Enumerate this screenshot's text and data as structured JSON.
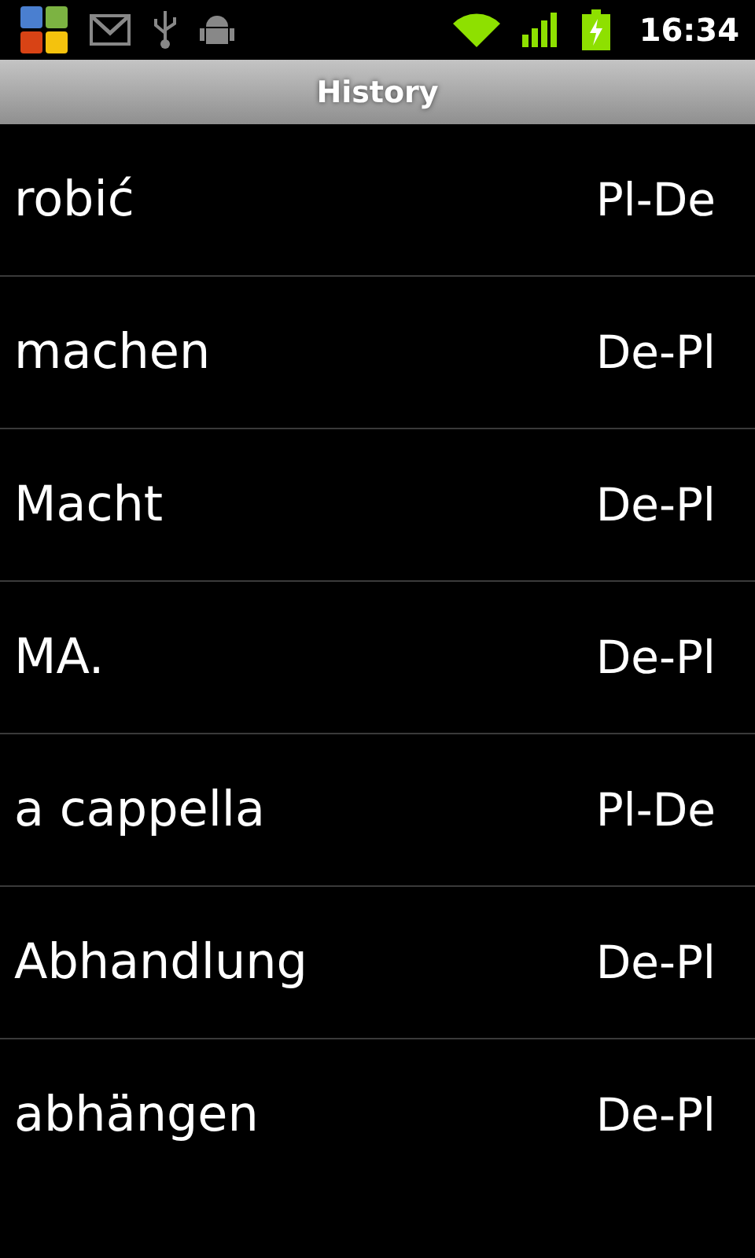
{
  "status_bar": {
    "time": "16:34"
  },
  "title_bar": {
    "title": "History"
  },
  "history": [
    {
      "word": "robić",
      "direction": "Pl-De"
    },
    {
      "word": "machen",
      "direction": "De-Pl"
    },
    {
      "word": "Macht",
      "direction": "De-Pl"
    },
    {
      "word": "MA.",
      "direction": "De-Pl"
    },
    {
      "word": "a cappella",
      "direction": "Pl-De"
    },
    {
      "word": "Abhandlung",
      "direction": "De-Pl"
    },
    {
      "word": "abhängen",
      "direction": "De-Pl"
    }
  ]
}
